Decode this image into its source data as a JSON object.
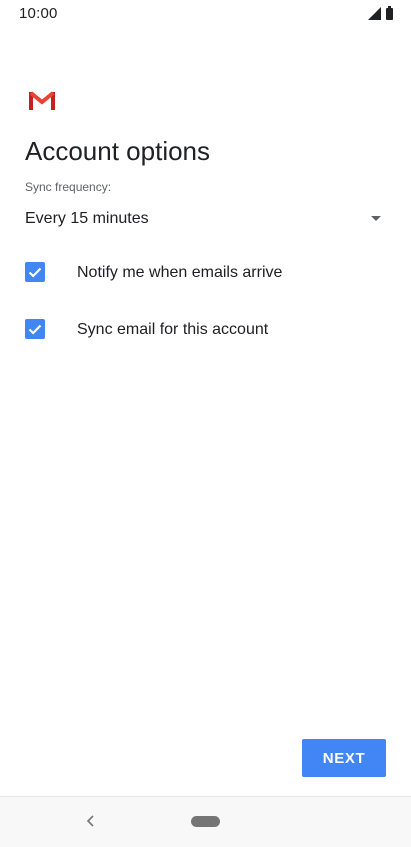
{
  "status_bar": {
    "time": "10:00",
    "icons": [
      "signal-icon",
      "battery-icon"
    ]
  },
  "app": {
    "logo_icon": "gmail-logo-icon",
    "brand_colors": [
      "#ea4335",
      "#c5221f"
    ]
  },
  "page": {
    "title": "Account options"
  },
  "sync": {
    "label": "Sync frequency:",
    "selected": "Every 15 minutes",
    "icon": "dropdown-arrow-icon"
  },
  "options": [
    {
      "label": "Notify me when emails arrive",
      "checked": true
    },
    {
      "label": "Sync email for this account",
      "checked": true
    }
  ],
  "footer": {
    "next_label": "NEXT",
    "accent_color": "#4285f4"
  },
  "nav_bar": {
    "icons": [
      "back-icon",
      "home-pill-icon"
    ]
  }
}
